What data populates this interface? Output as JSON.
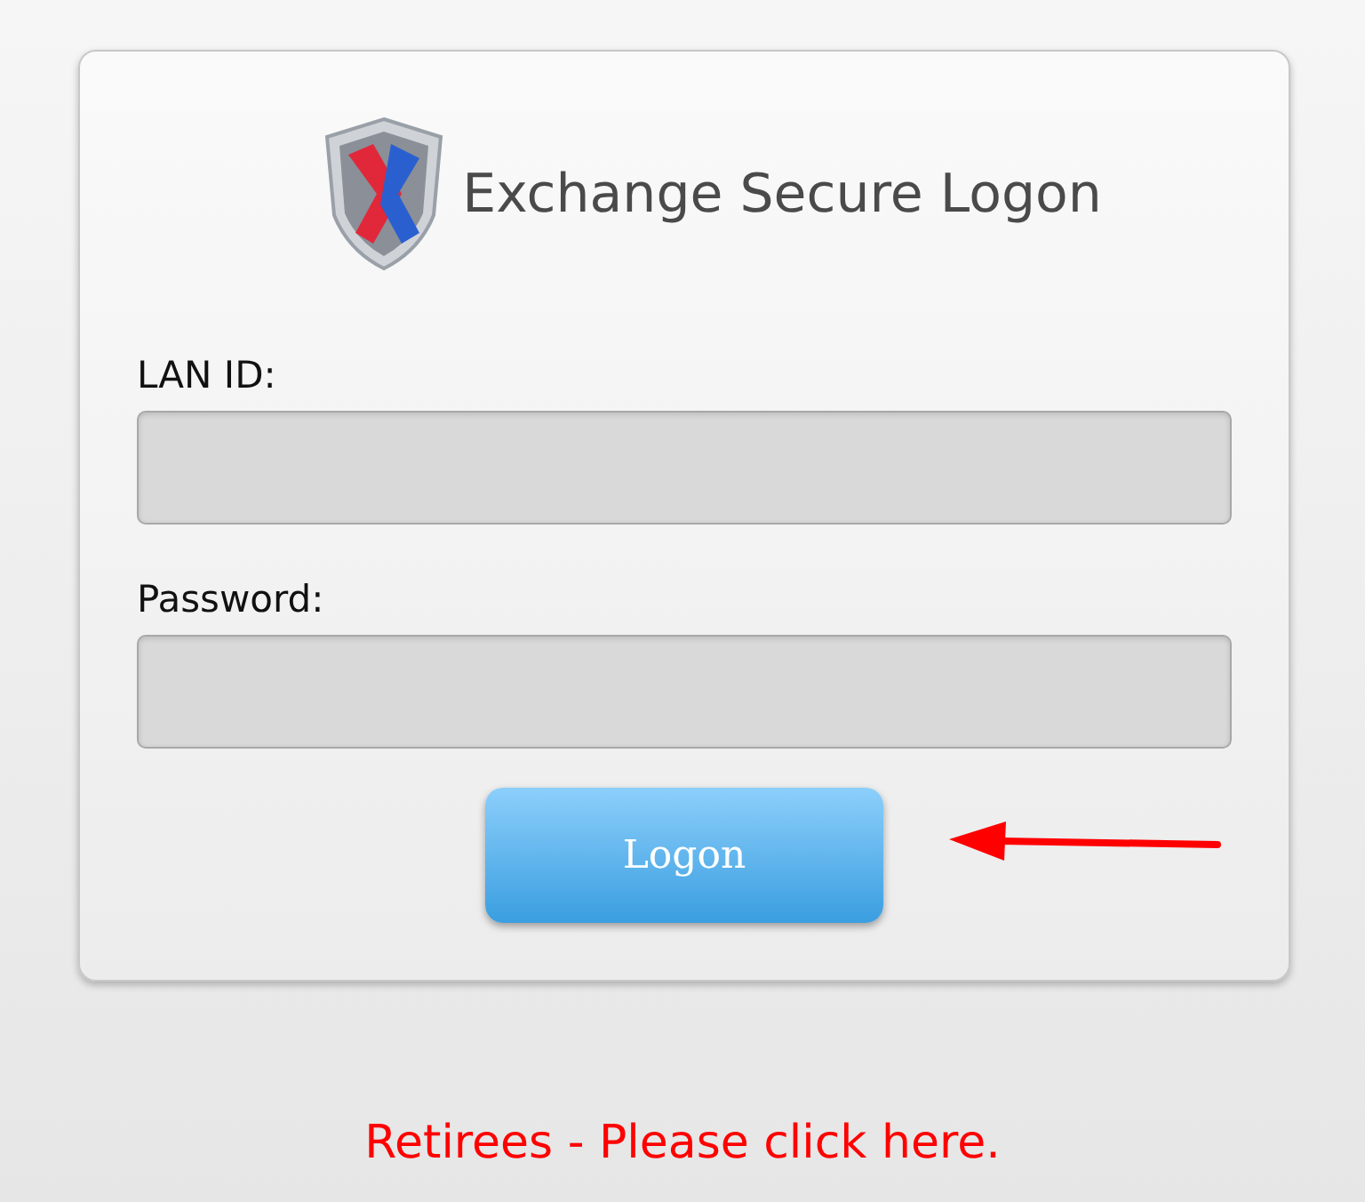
{
  "header": {
    "title": "Exchange Secure Logon"
  },
  "fields": [
    {
      "label": "LAN ID:"
    },
    {
      "label": "Password:"
    }
  ],
  "logon_button": {
    "label": "Logon"
  },
  "retirees_link": {
    "text": "Retirees - Please click here."
  }
}
